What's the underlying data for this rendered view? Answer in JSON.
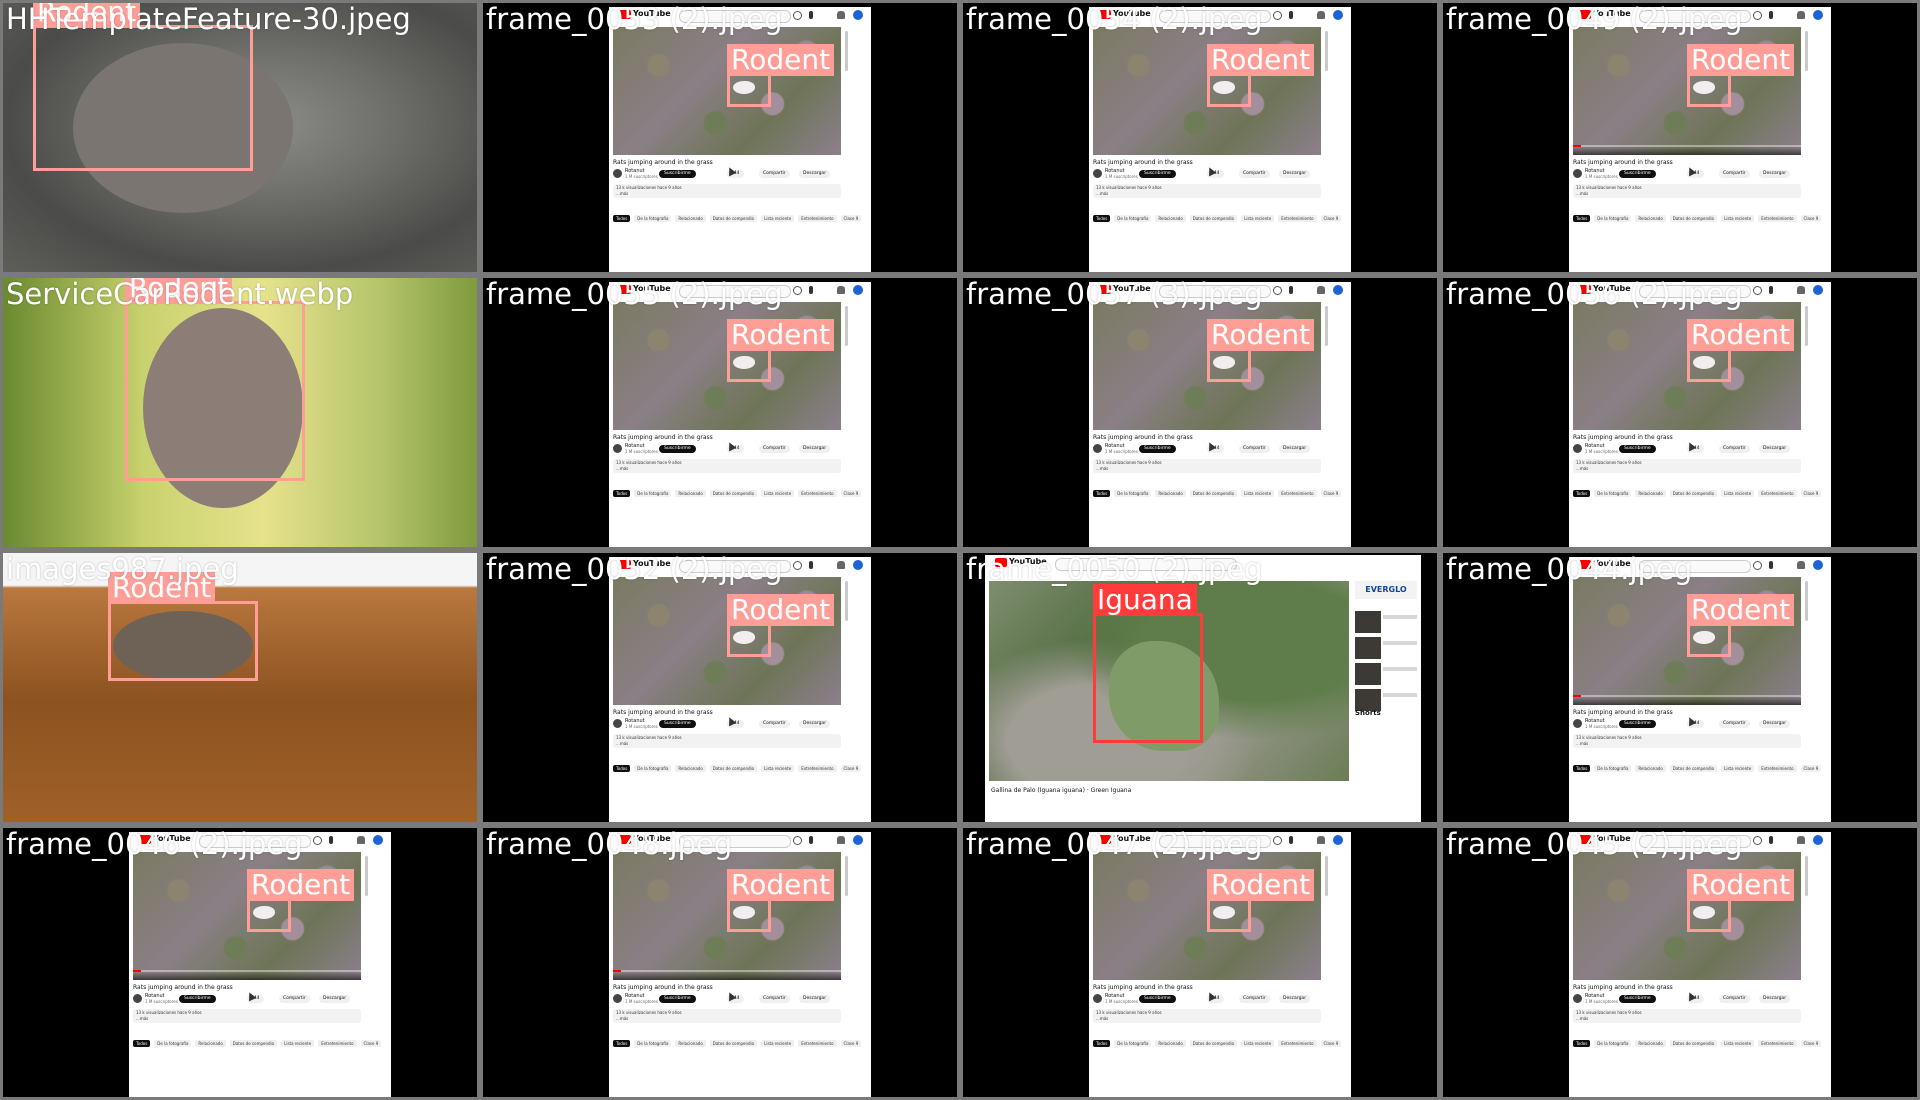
{
  "grid": {
    "background": "#7a7a7a",
    "detection_color": "#ff9d97",
    "tiles": [
      {
        "name": "HHTemplateFeature-30.jpeg",
        "title": "HHTemplateFeature-30.jpeg",
        "kind": "photo",
        "photo": "rat1",
        "detections": [
          {
            "label": "Rodent"
          }
        ]
      },
      {
        "name": "frame_0053 (2).jpeg",
        "title": "frame_0053 (2).jpeg",
        "kind": "yt",
        "variant": "plain",
        "detections": [
          {
            "label": "Rodent"
          }
        ]
      },
      {
        "name": "frame_0054 (2).jpeg",
        "title": "frame_0054 (2).jpeg",
        "kind": "yt",
        "variant": "plain",
        "detections": [
          {
            "label": "Rodent"
          }
        ]
      },
      {
        "name": "frame_0049 (2).jpeg",
        "title": "frame_0049 (2).jpeg",
        "kind": "yt",
        "variant": "controls",
        "detections": [
          {
            "label": "Rodent"
          }
        ]
      },
      {
        "name": "ServiceCarRodent.webp",
        "title": "ServiceCarRodent.webp",
        "kind": "photo",
        "photo": "rat2",
        "detections": [
          {
            "label": "Rodent"
          }
        ]
      },
      {
        "name": "frame_0055 (2).jpeg",
        "title": "frame_0055 (2).jpeg",
        "kind": "yt",
        "variant": "plain",
        "detections": [
          {
            "label": "Rodent"
          }
        ]
      },
      {
        "name": "frame_0057 (3).jpeg",
        "title": "frame_0057 (3).jpeg",
        "kind": "yt",
        "variant": "plain",
        "detections": [
          {
            "label": "Rodent"
          }
        ]
      },
      {
        "name": "frame_0056 (2).jpeg",
        "title": "frame_0056 (2).jpeg",
        "kind": "yt",
        "variant": "plain",
        "detections": [
          {
            "label": "Rodent"
          }
        ]
      },
      {
        "name": "images987.jpeg",
        "title": "images987.jpeg",
        "kind": "photo",
        "photo": "rat3",
        "detections": [
          {
            "label": "Rodent"
          }
        ]
      },
      {
        "name": "frame_0052 (2).jpeg",
        "title": "frame_0052 (2).jpeg",
        "kind": "yt",
        "variant": "plain",
        "detections": [
          {
            "label": "Rodent"
          }
        ]
      },
      {
        "name": "frame_0050 (2).jpeg",
        "title": "frame_0050 (2).jpeg",
        "kind": "iguana",
        "detections": [
          {
            "label": "Iguana"
          }
        ]
      },
      {
        "name": "frame_0044.jpeg",
        "title": "frame_0044.jpeg",
        "kind": "yt",
        "variant": "controls",
        "detections": [
          {
            "label": "Rodent"
          }
        ]
      },
      {
        "name": "frame_0046 (2).jpeg",
        "title": "frame_0046 (2).jpeg",
        "kind": "yt",
        "variant": "controls",
        "detections": [
          {
            "label": "Rodent"
          }
        ]
      },
      {
        "name": "frame_0048.jpeg",
        "title": "frame_0048.jpeg",
        "kind": "yt",
        "variant": "controls",
        "detections": [
          {
            "label": "Rodent"
          }
        ]
      },
      {
        "name": "frame_0047 (2).jpeg",
        "title": "frame_0047 (2).jpeg",
        "kind": "yt",
        "variant": "plain",
        "detections": [
          {
            "label": "Rodent"
          }
        ]
      },
      {
        "name": "frame_0045 (2).jpeg",
        "title": "frame_0045 (2).jpeg",
        "kind": "yt",
        "variant": "plain",
        "detections": [
          {
            "label": "Rodent"
          }
        ]
      }
    ]
  },
  "youtube": {
    "logo_text": "YouTube",
    "video_title": "Rats jumping around in the grass",
    "channel_name": "Rotanut",
    "channel_subs": "1 M suscriptores",
    "subscribe_label": "Suscribirme",
    "likes_label": "644",
    "share_label": "Compartir",
    "download_label": "Descargar",
    "desc_line1": "13 k visualizaciones hace 9 años",
    "desc_line2": "...más",
    "chips": [
      "Todos",
      "De la fotografía",
      "Relacionado",
      "Datos de compendio",
      "Lista reciente",
      "Entretenimiento",
      "Clase 9"
    ],
    "brand_color": "#ff0000"
  },
  "iguana_page": {
    "side_header": "EVERGLO",
    "shorts_label": "Shorts",
    "caption": "Gallina de Palo (Iguana iguana) · Green Iguana"
  }
}
